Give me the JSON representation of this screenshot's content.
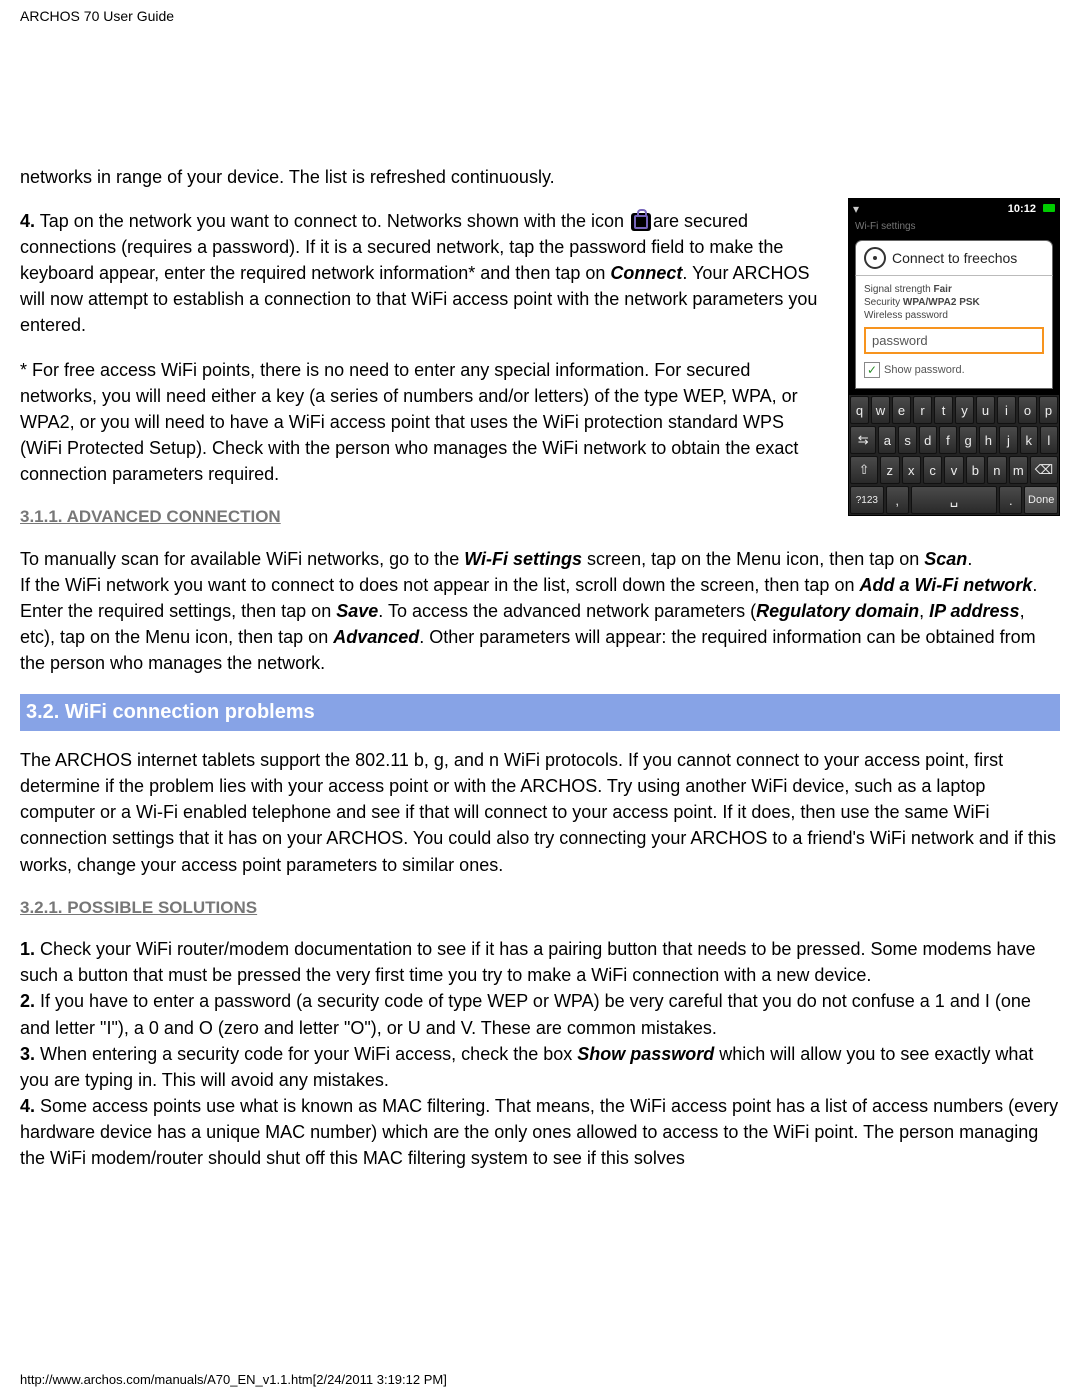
{
  "header_title": "ARCHOS 70 User Guide",
  "screenshot": {
    "time": "10:12",
    "subtitle": "Wi-Fi settings",
    "dialog_title": "Connect to freechos",
    "signal_label": "Signal strength",
    "signal_value": "Fair",
    "security_label": "Security",
    "security_value": "WPA/WPA2 PSK",
    "pw_label": "Wireless password",
    "pw_value": "password",
    "show_pw": "Show password.",
    "keyboard": {
      "row1": [
        "q",
        "w",
        "e",
        "r",
        "t",
        "y",
        "u",
        "i",
        "o",
        "p"
      ],
      "row2": [
        "a",
        "s",
        "d",
        "f",
        "g",
        "h",
        "j",
        "k",
        "l"
      ],
      "row3": [
        "z",
        "x",
        "c",
        "v",
        "b",
        "n",
        "m"
      ],
      "shift": "⇧",
      "back": "⌫",
      "sym": "?123",
      "comma": ",",
      "space": "␣",
      "period": ".",
      "done": "Done"
    }
  },
  "body": {
    "intro1": "networks in range of your device. The list is refreshed continuously.",
    "step4_a": "4.",
    "step4_b": " Tap on the network you want to connect to. Networks shown with the icon ",
    "step4_c": "are secured connections (requires a password).  If it is a secured network, tap the password field to make the keyboard appear, enter the required network information* and then tap on ",
    "connect": "Connect",
    "step4_d": ". Your ARCHOS will now attempt to establish a connection to that WiFi access point with the network parameters you entered.",
    "footnote": "* For free access WiFi points, there is no need to enter any special information. For secured networks, you will need either a key (a series of numbers and/or letters) of the type WEP, WPA, or WPA2, or you will need to have a WiFi access point that uses the WiFi protection standard WPS (WiFi Protected Setup). Check with the person who manages the WiFi network to obtain the exact connection parameters required.",
    "h_311": "3.1.1. ADVANCED CONNECTION",
    "p_311a": "To manually scan for available WiFi networks, go to the ",
    "wifi_settings": "Wi-Fi settings",
    "p_311b": " screen, tap on the Menu icon, then tap on ",
    "scan": "Scan",
    "p_311c": ".",
    "p_311d": "If the WiFi network you want to connect to does not appear in the list, scroll down the screen, then tap on ",
    "add_wifi": "Add a Wi-Fi network",
    "p_311e": ". Enter the required settings, then tap on ",
    "save": "Save",
    "p_311f": ". To access the advanced network parameters (",
    "reg_domain": "Regulatory domain",
    "p_311g": ", ",
    "ip": "IP address",
    "p_311h": ", etc), tap on the Menu icon, then tap on ",
    "advanced": "Advanced",
    "p_311i": ". Other parameters will appear: the required information can be obtained from the person who manages the network.",
    "h_32": "3.2. WiFi connection problems",
    "p_32": "The ARCHOS internet tablets support the 802.11 b, g, and n WiFi protocols. If you cannot connect to your access point, first determine if the problem lies with your access point or with the ARCHOS.  Try using another WiFi device, such as a laptop computer or a Wi-Fi enabled telephone and see if that will connect to your access point. If it does, then use the same WiFi connection settings that it has on your ARCHOS.  You could also try connecting your ARCHOS to a friend's WiFi network and if this works, change your access point parameters to similar ones.",
    "h_321": "3.2.1. POSSIBLE SOLUTIONS",
    "sol1_a": "1.",
    "sol1_b": " Check your WiFi router/modem documentation to see if it has a pairing button that needs to be pressed. Some modems have such a button that must be pressed the very first time you try to make a WiFi connection with a new device.",
    "sol2_a": "2.",
    "sol2_b": " If you have to enter a password (a security code of type WEP or WPA) be very careful that you do not confuse a 1 and I (one and letter \"I\"), a 0 and O (zero and letter \"O\"), or U and V. These are common mistakes.",
    "sol3_a": "3.",
    "sol3_b": " When entering a security code for your WiFi access, check the box ",
    "show_password": "Show password",
    "sol3_c": " which will allow you to see exactly what you are typing in. This will avoid any mistakes.",
    "sol4_a": "4.",
    "sol4_b": " Some access points use what is known as MAC filtering. That means, the WiFi access point has a list of access numbers (every hardware device has a unique MAC number) which are the only ones allowed to access to the WiFi point. The person managing the WiFi modem/router should shut off this MAC filtering system to see if this solves"
  },
  "footer_url": "http://www.archos.com/manuals/A70_EN_v1.1.htm[2/24/2011 3:19:12 PM]"
}
